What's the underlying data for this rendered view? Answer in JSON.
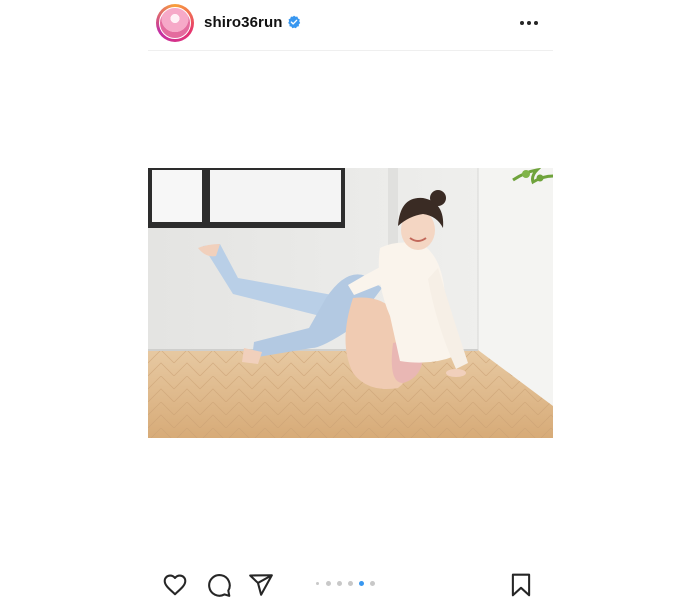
{
  "post": {
    "username": "shiro36run",
    "verified": true,
    "avatar_icon": "profile-avatar-icon",
    "more_icon": "more-options-icon"
  },
  "media": {
    "image_icon": "photo-image",
    "carousel": {
      "total": 5,
      "active_index": 3
    }
  },
  "actions": {
    "like_icon": "heart-icon",
    "comment_icon": "comment-bubble-icon",
    "share_icon": "paper-plane-icon",
    "save_icon": "bookmark-icon"
  },
  "colors": {
    "verified_blue": "#3897f0",
    "active_dot": "#3897f0",
    "inactive_dot": "#c8c8c8",
    "icon": "#262626"
  }
}
